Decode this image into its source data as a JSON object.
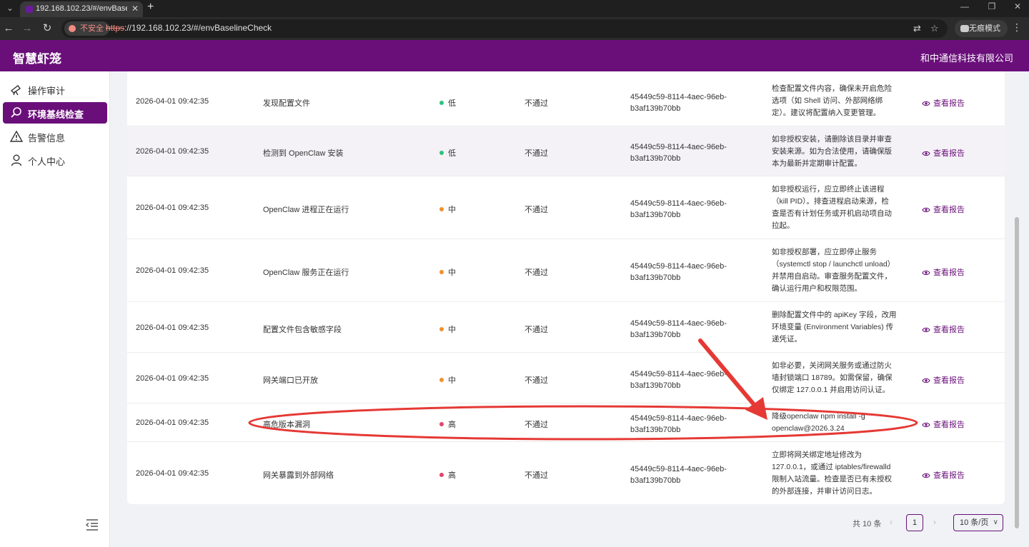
{
  "browser": {
    "tab_title": "192.168.102.23/#/envBaselin",
    "url_scheme": "https",
    "url_rest": "://192.168.102.23/#/envBaselineCheck",
    "insecure_label": "不安全",
    "incognito_label": "无痕模式"
  },
  "app": {
    "title": "智慧虾笼",
    "company": "和中通信科技有限公司"
  },
  "sidebar": {
    "items": [
      {
        "label": "操作审计",
        "icon": "telescope-icon",
        "active": false
      },
      {
        "label": "环境基线检查",
        "icon": "search-icon",
        "active": true
      },
      {
        "label": "告警信息",
        "icon": "warning-icon",
        "active": false
      },
      {
        "label": "个人中心",
        "icon": "user-icon",
        "active": false
      }
    ]
  },
  "table": {
    "rows": [
      {
        "time": "2026-04-01 09:42:35",
        "item": "发现配置文件",
        "level": "低",
        "level_color": "#2ec27e",
        "result": "不通过",
        "id_line1": "45449c59-8114-4aec-96eb-",
        "id_line2": "b3af139b70bb",
        "suggestion": [
          "检查配置文件内容，确保未开启危险",
          "选项（如 Shell 访问、外部网络绑",
          "定）。建议将配置纳入变更管理。"
        ],
        "action": "查看报告"
      },
      {
        "time": "2026-04-01 09:42:35",
        "item": "检测到 OpenClaw 安装",
        "level": "低",
        "level_color": "#2ec27e",
        "result": "不通过",
        "id_line1": "45449c59-8114-4aec-96eb-",
        "id_line2": "b3af139b70bb",
        "suggestion": [
          "如非授权安装，请删除该目录并审查",
          "安装来源。如为合法使用，请确保版",
          "本为最新并定期审计配置。"
        ],
        "action": "查看报告"
      },
      {
        "time": "2026-04-01 09:42:35",
        "item": "OpenClaw 进程正在运行",
        "level": "中",
        "level_color": "#f0902f",
        "result": "不通过",
        "id_line1": "45449c59-8114-4aec-96eb-",
        "id_line2": "b3af139b70bb",
        "suggestion": [
          "如非授权运行，应立即终止该进程",
          "（kill PID）。排查进程启动来源，检",
          "查是否有计划任务或开机启动项自动",
          "拉起。"
        ],
        "action": "查看报告"
      },
      {
        "time": "2026-04-01 09:42:35",
        "item": "OpenClaw 服务正在运行",
        "level": "中",
        "level_color": "#f0902f",
        "result": "不通过",
        "id_line1": "45449c59-8114-4aec-96eb-",
        "id_line2": "b3af139b70bb",
        "suggestion": [
          "如非授权部署，应立即停止服务",
          "（systemctl stop / launchctl unload）",
          "并禁用自启动。审查服务配置文件，",
          "确认运行用户和权限范围。"
        ],
        "action": "查看报告"
      },
      {
        "time": "2026-04-01 09:42:35",
        "item": "配置文件包含敏感字段",
        "level": "中",
        "level_color": "#f0902f",
        "result": "不通过",
        "id_line1": "45449c59-8114-4aec-96eb-",
        "id_line2": "b3af139b70bb",
        "suggestion": [
          "删除配置文件中的 apiKey 字段，改用",
          "环境变量 (Environment Variables) 传",
          "递凭证。"
        ],
        "action": "查看报告"
      },
      {
        "time": "2026-04-01 09:42:35",
        "item": "网关端口已开放",
        "level": "中",
        "level_color": "#f0902f",
        "result": "不通过",
        "id_line1": "45449c59-8114-4aec-96eb-",
        "id_line2": "b3af139b70bb",
        "suggestion": [
          "如非必要，关闭网关服务或通过防火",
          "墙封锁端口 18789。如需保留，确保",
          "仅绑定 127.0.0.1 并启用访问认证。"
        ],
        "action": "查看报告"
      },
      {
        "time": "2026-04-01 09:42:35",
        "item": "高危版本漏洞",
        "level": "高",
        "level_color": "#e0456b",
        "result": "不通过",
        "id_line1": "45449c59-8114-4aec-96eb-",
        "id_line2": "b3af139b70bb",
        "suggestion": [
          "降级openclaw npm install -g",
          "openclaw@2026.3.24"
        ],
        "action": "查看报告"
      },
      {
        "time": "2026-04-01 09:42:35",
        "item": "网关暴露到外部网络",
        "level": "高",
        "level_color": "#e0456b",
        "result": "不通过",
        "id_line1": "45449c59-8114-4aec-96eb-",
        "id_line2": "b3af139b70bb",
        "suggestion": [
          "立即将网关绑定地址修改为",
          "127.0.0.1，或通过 iptables/firewalld",
          "限制入站流量。检查是否已有未授权",
          "的外部连接，并审计访问日志。"
        ],
        "action": "查看报告"
      }
    ]
  },
  "pagination": {
    "total": "共 10 条",
    "current": "1",
    "page_size": "10 条/页"
  },
  "annotation_color": "#e53935"
}
